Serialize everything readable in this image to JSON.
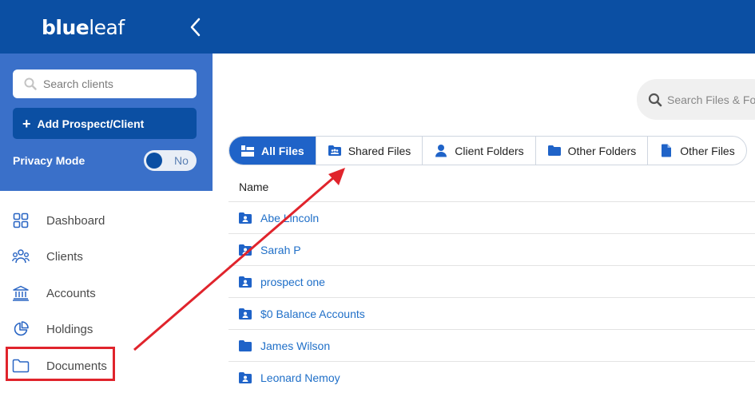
{
  "brand": {
    "name_bold": "blue",
    "name_light": "leaf"
  },
  "sidebar": {
    "search_placeholder": "Search clients",
    "add_button": "Add Prospect/Client",
    "privacy_label": "Privacy Mode",
    "privacy_value": "No",
    "nav": [
      {
        "label": "Dashboard",
        "icon": "dashboard-grid-icon"
      },
      {
        "label": "Clients",
        "icon": "clients-icon"
      },
      {
        "label": "Accounts",
        "icon": "bank-icon"
      },
      {
        "label": "Holdings",
        "icon": "pie-chart-icon"
      },
      {
        "label": "Documents",
        "icon": "folder-outline-icon"
      }
    ]
  },
  "main": {
    "search_placeholder": "Search Files & Folders",
    "tabs": [
      {
        "label": "All Files",
        "icon": "all-files-icon",
        "active": true
      },
      {
        "label": "Shared Files",
        "icon": "shared-folder-icon"
      },
      {
        "label": "Client Folders",
        "icon": "person-icon"
      },
      {
        "label": "Other Folders",
        "icon": "folder-icon"
      },
      {
        "label": "Other Files",
        "icon": "file-icon"
      }
    ],
    "column_header": "Name",
    "rows": [
      {
        "name": "Abe Lincoln",
        "icon": "client-folder-icon"
      },
      {
        "name": "Sarah P",
        "icon": "client-folder-icon"
      },
      {
        "name": "prospect one",
        "icon": "client-folder-icon"
      },
      {
        "name": "$0 Balance Accounts",
        "icon": "client-folder-icon"
      },
      {
        "name": "James Wilson",
        "icon": "folder-icon"
      },
      {
        "name": "Leonard Nemoy",
        "icon": "client-folder-icon"
      }
    ]
  },
  "colors": {
    "brand_blue": "#0b4fa3",
    "panel_blue": "#3a70c9",
    "tab_active": "#1f63c8",
    "link": "#1f6fc8",
    "annotation_red": "#e0242c"
  }
}
